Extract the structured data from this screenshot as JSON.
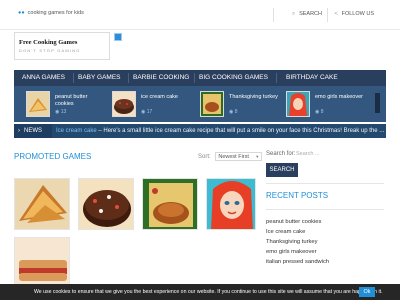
{
  "topbar": {
    "site_link": "cooking games for kids",
    "search_label": "SEARCH",
    "follow_label": "FOLLOW US"
  },
  "header": {
    "logo_title": "Free Cooking Games",
    "logo_tagline": "DON'T STOP GAMING"
  },
  "nav": {
    "items": [
      {
        "label": "ANNA GAMES"
      },
      {
        "label": "BABY GAMES"
      },
      {
        "label": "BARBIE COOKING"
      },
      {
        "label": "BIG COOKING GAMES"
      },
      {
        "label": "BIRTHDAY CAKE"
      }
    ]
  },
  "slider": {
    "items": [
      {
        "title_line1": "peanut butter",
        "title_line2": "cookies",
        "views": "13"
      },
      {
        "title_line1": "ice cream cake",
        "title_line2": "",
        "views": "17"
      },
      {
        "title_line1": "Thanksgiving turkey",
        "title_line2": "",
        "views": "8"
      },
      {
        "title_line1": "emo girls makeover",
        "title_line2": "",
        "views": "8"
      }
    ]
  },
  "ticker": {
    "label": "NEWS",
    "headline": "Ice cream cake",
    "text": " – Here's a small little ice cream cake recipe that will put a smile on your face this Christmas! Break up the ..."
  },
  "main": {
    "section_title": "PROMOTED GAMES",
    "sort_label": "Sort:",
    "sort_value": "Newest First"
  },
  "sidebar": {
    "search_label": "Search for:",
    "search_placeholder": "Search ...",
    "search_button": "SEARCH",
    "recent_title": "RECENT POSTS",
    "recent_posts": [
      "peanut butter cookies",
      "Ice cream cake",
      "Thanksgiving turkey",
      "emo girls makeover",
      "italian pressed sandwich"
    ]
  },
  "cookie": {
    "message": "We use cookies to ensure that we give you the best experience on our website. If you continue to use this site we will assume that you are happy with it.",
    "ok": "Ok"
  },
  "colors": {
    "accent": "#1f8fd8",
    "nav_bg": "#2a3f5e",
    "slider_bg": "#34577f",
    "ticker_bg": "#24496f",
    "cookie_bg": "#262626"
  },
  "icons": [
    "flickr-icon",
    "search-icon",
    "share-icon",
    "eye-icon",
    "chevron-right-icon",
    "sort-caret-icon"
  ]
}
